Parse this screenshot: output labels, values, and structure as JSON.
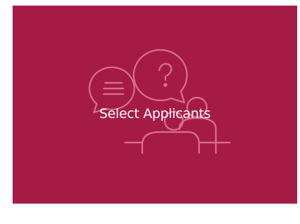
{
  "tile": {
    "label": "Select Applicants",
    "icon": "applicants-discussion-icon",
    "background_color": "#A61B46",
    "icon_stroke_color": "#D77191"
  }
}
